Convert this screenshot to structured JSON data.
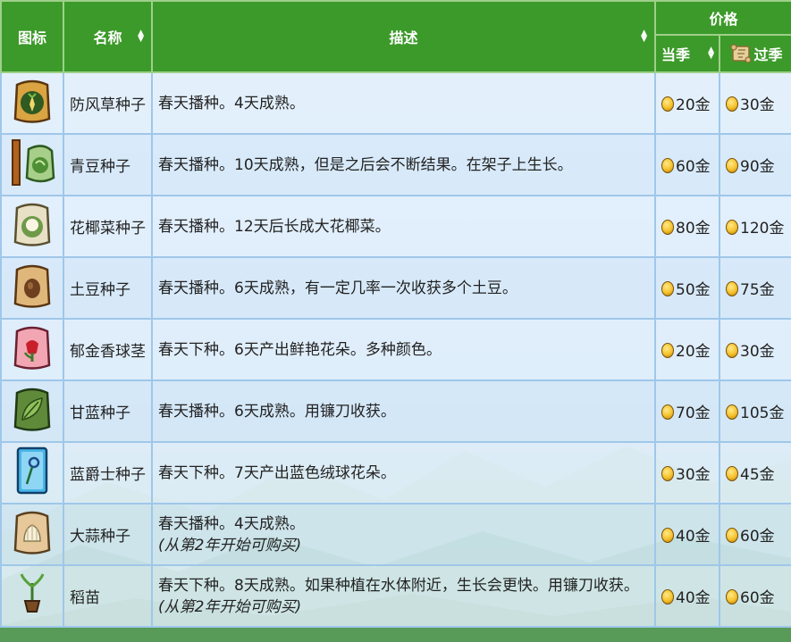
{
  "header": {
    "icon": "图标",
    "name": "名称",
    "desc": "描述",
    "price": "价格",
    "in_season": "当季",
    "off_season": "过季"
  },
  "rows": [
    {
      "name": "防风草种子",
      "desc": "春天播种。4天成熟。",
      "note": "",
      "in_season": "20金",
      "off_season": "30金",
      "icon": "parsnip-seeds-icon"
    },
    {
      "name": "青豆种子",
      "desc": "春天播种。10天成熟，但是之后会不断结果。在架子上生长。",
      "note": "",
      "in_season": "60金",
      "off_season": "90金",
      "icon": "bean-starter-icon"
    },
    {
      "name": "花椰菜种子",
      "desc": "春天播种。12天后长成大花椰菜。",
      "note": "",
      "in_season": "80金",
      "off_season": "120金",
      "icon": "cauliflower-seeds-icon"
    },
    {
      "name": "土豆种子",
      "desc": "春天播种。6天成熟，有一定几率一次收获多个土豆。",
      "note": "",
      "in_season": "50金",
      "off_season": "75金",
      "icon": "potato-seeds-icon"
    },
    {
      "name": "郁金香球茎",
      "desc": "春天下种。6天产出鲜艳花朵。多种颜色。",
      "note": "",
      "in_season": "20金",
      "off_season": "30金",
      "icon": "tulip-bulb-icon"
    },
    {
      "name": "甘蓝种子",
      "desc": "春天播种。6天成熟。用镰刀收获。",
      "note": "",
      "in_season": "70金",
      "off_season": "105金",
      "icon": "kale-seeds-icon"
    },
    {
      "name": "蓝爵士种子",
      "desc": "春天下种。7天产出蓝色绒球花朵。",
      "note": "",
      "in_season": "30金",
      "off_season": "45金",
      "icon": "jazz-seeds-icon"
    },
    {
      "name": "大蒜种子",
      "desc": "春天播种。4天成熟。",
      "note": "(从第2年开始可购买)",
      "in_season": "40金",
      "off_season": "60金",
      "icon": "garlic-seeds-icon"
    },
    {
      "name": "稻苗",
      "desc": "春天下种。8天成熟。如果种植在水体附近，生长会更快。用镰刀收获。",
      "note": "(从第2年开始可购买)",
      "in_season": "40金",
      "off_season": "60金",
      "icon": "rice-shoot-icon"
    }
  ],
  "colors": {
    "header_bg": "#3c9a2a",
    "link": "#2f4fa8",
    "border": "#9fc7ea"
  }
}
